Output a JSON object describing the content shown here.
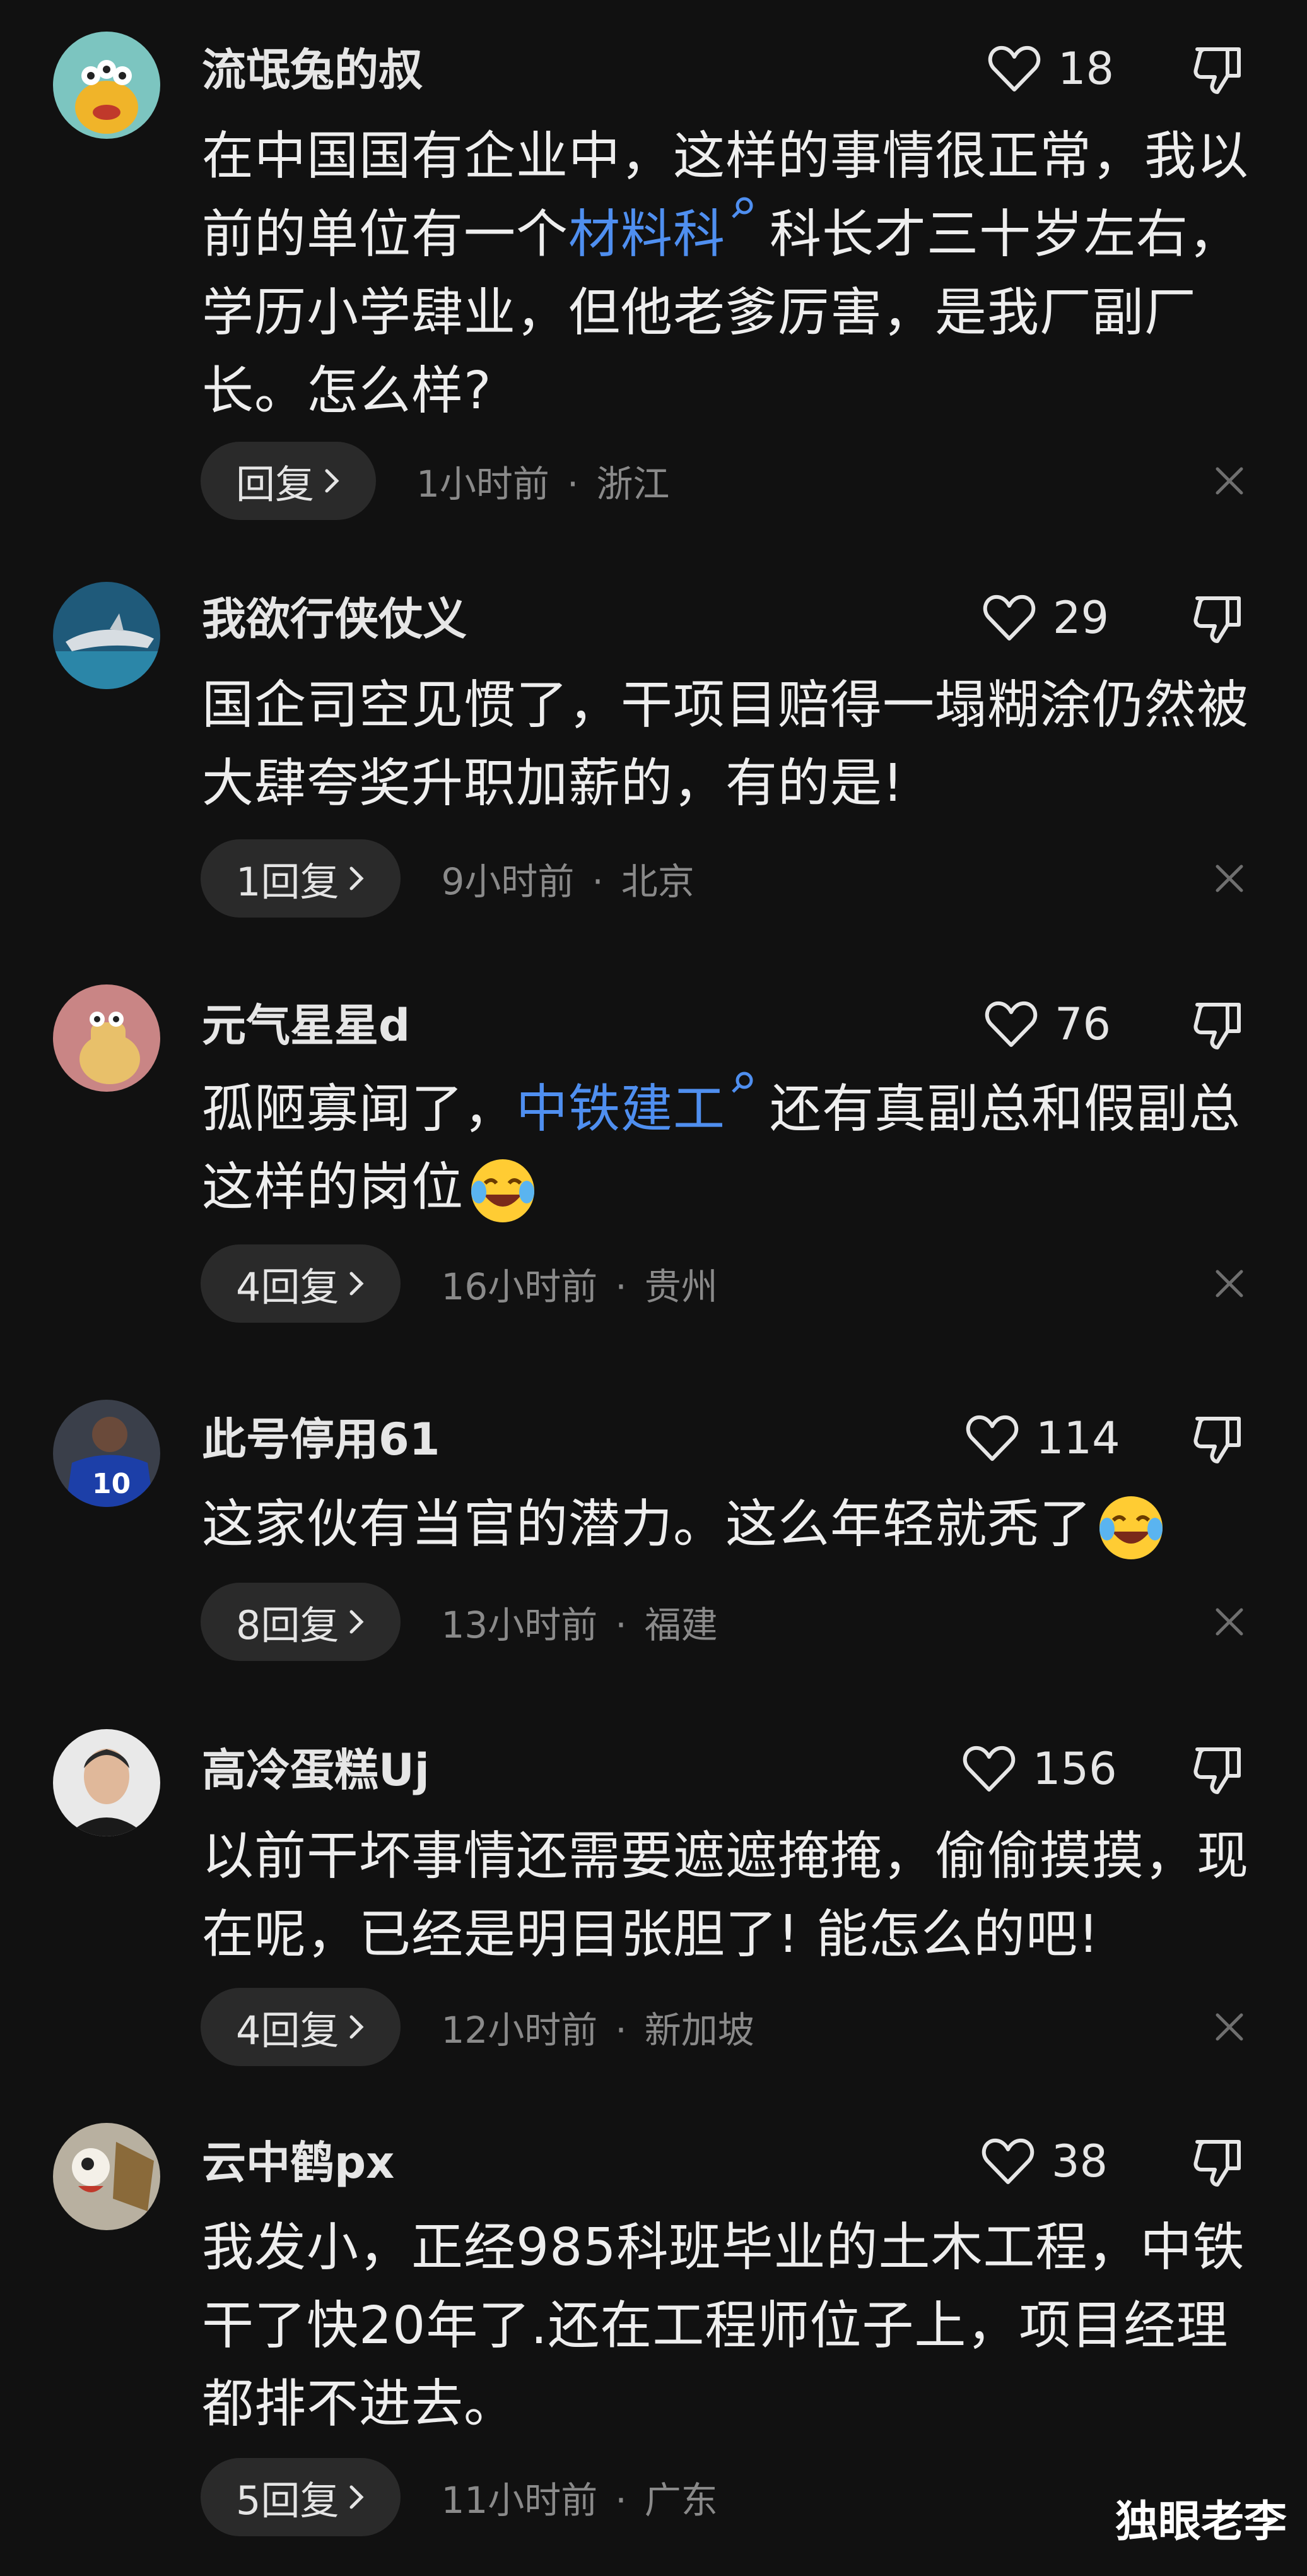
{
  "comments": [
    {
      "username": "流氓兔的叔",
      "likes": "18",
      "text_parts": [
        {
          "t": "在中国国有企业中，这样的事情很正常，我以前的单位有一个"
        },
        {
          "t": "材料科",
          "kw": true
        },
        {
          "t": "科长才三十岁左右，学历小学肆业，但他老爹厉害，是我厂副厂长。怎么样?"
        }
      ],
      "reply_label": "回复",
      "time": "1小时前",
      "region": "浙江",
      "avatar": "cartoon-monster-avatar"
    },
    {
      "username": "我欲行侠仗义",
      "likes": "29",
      "text_parts": [
        {
          "t": "国企司空见惯了，干项目赔得一塌糊涂仍然被大肆夸奖升职加薪的，有的是!"
        }
      ],
      "reply_label": "1回复",
      "time": "9小时前",
      "region": "北京",
      "avatar": "shark-avatar"
    },
    {
      "username": "元气星星d",
      "likes": "76",
      "text_parts": [
        {
          "t": "孤陋寡闻了，"
        },
        {
          "t": "中铁建工",
          "kw": true
        },
        {
          "t": "还有真副总和假副总这样的岗位"
        }
      ],
      "emoji": "laughing-crying-emoji",
      "reply_label": "4回复",
      "time": "16小时前",
      "region": "贵州",
      "avatar": "cartoon-character-avatar"
    },
    {
      "username": "此号停用61",
      "likes": "114",
      "text_parts": [
        {
          "t": "这家伙有当官的潜力。这么年轻就秃了"
        }
      ],
      "emoji": "laughing-crying-emoji",
      "reply_label": "8回复",
      "time": "13小时前",
      "region": "福建",
      "avatar": "football-player-avatar"
    },
    {
      "username": "高冷蛋糕Uj",
      "likes": "156",
      "text_parts": [
        {
          "t": "以前干坏事情还需要遮遮掩掩，偷偷摸摸，现在呢，已经是明目张胆了! 能怎么的吧!"
        }
      ],
      "reply_label": "4回复",
      "time": "12小时前",
      "region": "新加坡",
      "avatar": "man-portrait-avatar"
    },
    {
      "username": "云中鹤px",
      "likes": "38",
      "text_parts": [
        {
          "t": "我发小，正经985科班毕业的土木工程，中铁干了快20年了.还在工程师位子上，项目经理都排不进去。"
        }
      ],
      "reply_label": "5回复",
      "time": "11小时前",
      "region": "广东",
      "avatar": "cartoon-face-avatar"
    }
  ],
  "watermark": "独眼老李",
  "colors": {
    "background": "#111111",
    "keyword_link": "#4f8ff0",
    "meta_text": "#8a8a8a",
    "reply_pill": "#2a2a2a"
  },
  "icons": [
    "heart-outline-icon",
    "thumbs-down-icon",
    "chevron-right-icon",
    "close-icon",
    "search-magnifier-icon"
  ]
}
